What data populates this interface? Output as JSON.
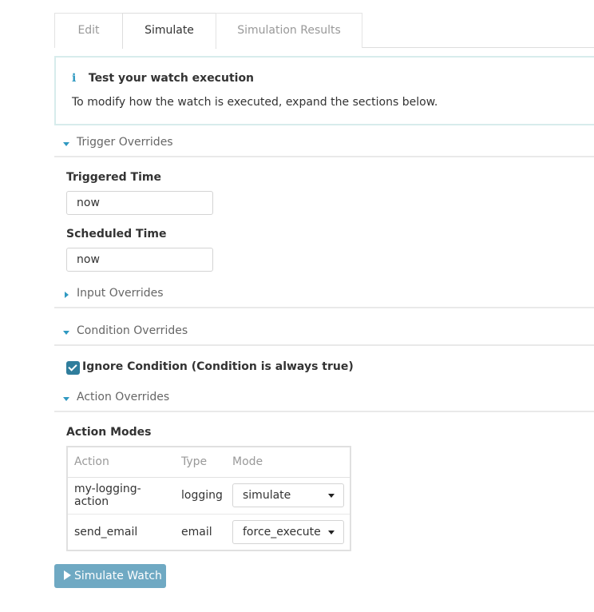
{
  "tabs": [
    {
      "label": "Edit",
      "active": false
    },
    {
      "label": "Simulate",
      "active": true
    },
    {
      "label": "Simulation Results",
      "active": false
    }
  ],
  "callout": {
    "icon": "info-icon",
    "title": "Test your watch execution",
    "body": "To modify how the watch is executed, expand the sections below."
  },
  "sections": {
    "trigger": {
      "label": "Trigger Overrides",
      "expanded": true
    },
    "input": {
      "label": "Input Overrides",
      "expanded": false
    },
    "condition": {
      "label": "Condition Overrides",
      "expanded": true
    },
    "action": {
      "label": "Action Overrides",
      "expanded": true
    }
  },
  "trigger": {
    "triggered_label": "Triggered Time",
    "triggered_value": "now",
    "scheduled_label": "Scheduled Time",
    "scheduled_value": "now"
  },
  "condition": {
    "ignore_label": "Ignore Condition (Condition is always true)",
    "ignore_checked": true
  },
  "action_modes": {
    "title": "Action Modes",
    "columns": [
      "Action",
      "Type",
      "Mode"
    ],
    "rows": [
      {
        "action": "my-logging-action",
        "type": "logging",
        "mode": "simulate"
      },
      {
        "action": "send_email",
        "type": "email",
        "mode": "force_execute"
      }
    ]
  },
  "simulate_button": {
    "label": "Simulate Watch"
  },
  "colors": {
    "accent": "#2f99c1",
    "button": "#6fa9c3",
    "checkbox": "#2f7d9c"
  }
}
